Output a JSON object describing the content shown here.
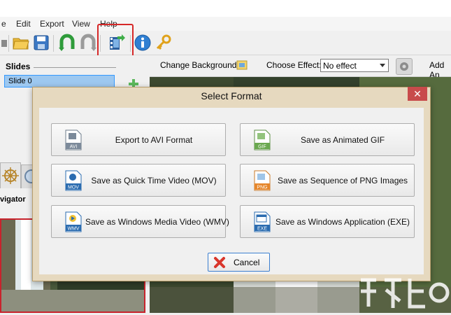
{
  "menu": {
    "items": [
      {
        "label": "e"
      },
      {
        "label": "Edit"
      },
      {
        "label": "Export"
      },
      {
        "label": "View"
      },
      {
        "label": "Help"
      }
    ]
  },
  "toolbar": {
    "icons": [
      "open-folder-icon",
      "save-icon",
      "undo-icon",
      "redo-icon",
      "export-film-icon",
      "info-icon",
      "key-icon"
    ]
  },
  "left_panel": {
    "slides_label": "Slides",
    "slide_item": "Slide 0",
    "navigator_label": "vigator"
  },
  "effects_bar": {
    "change_background": "Change Background",
    "choose_effect": "Choose Effect:",
    "effect_value": "No effect",
    "add_label": "Add An"
  },
  "dialog": {
    "title": "Select Format",
    "close_glyph": "✕",
    "buttons": [
      {
        "label": "Export to AVI Format",
        "badge": "AVI",
        "badge_color": "#7c8a9a"
      },
      {
        "label": "Save as Animated GIF",
        "badge": "GIF",
        "badge_color": "#6aa84f"
      },
      {
        "label": "Save as Quick Time Video (MOV)",
        "badge": "MOV",
        "badge_color": "#2b6cb0"
      },
      {
        "label": "Save as Sequence of PNG Images",
        "badge": "PNG",
        "badge_color": "#e6862a"
      },
      {
        "label": "Save as Windows Media Video (WMV)",
        "badge": "WMV",
        "badge_color": "#2b6cb0"
      },
      {
        "label": "Save as Windows Application (EXE)",
        "badge": "EXE",
        "badge_color": "#2b6cb0"
      }
    ],
    "cancel_label": "Cancel"
  },
  "colors": {
    "highlight": "#d62828",
    "dialog_frame": "#e6d9bf",
    "close_button": "#c84b4b",
    "selection": "#9dc8f0"
  }
}
